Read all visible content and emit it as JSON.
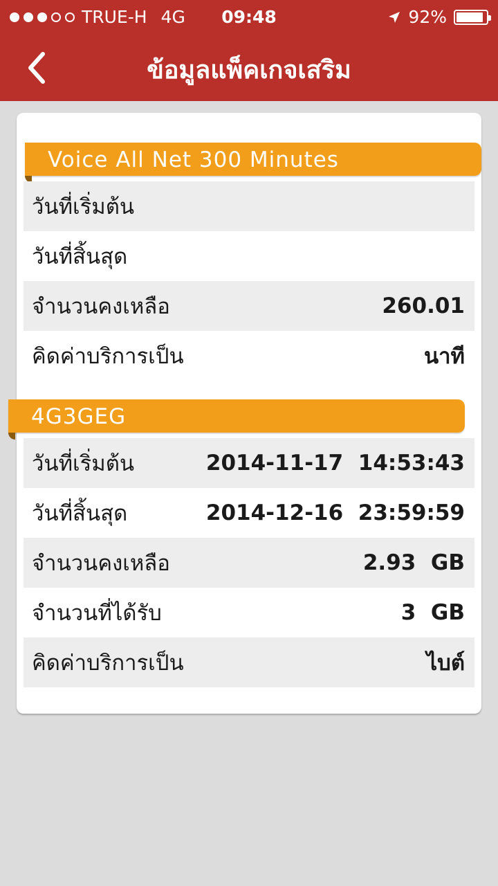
{
  "status_bar": {
    "signal_dots_filled": 3,
    "signal_dots_total": 5,
    "carrier": "TRUE-H",
    "network": "4G",
    "time": "09:48",
    "battery": "92%",
    "battery_level": 0.92
  },
  "header": {
    "title": "ข้อมูลแพ็คเกจเสริม",
    "back_icon": "chevron-left-icon"
  },
  "colors": {
    "header_bg": "#b9302b",
    "section_bg": "#f29e1a",
    "page_bg": "#dcdcdc"
  },
  "packages": [
    {
      "name": "Voice All Net 300 Minutes",
      "rows": [
        {
          "label": "วันที่เริ่มต้น",
          "value": ""
        },
        {
          "label": "วันที่สิ้นสุด",
          "value": ""
        },
        {
          "label": "จำนวนคงเหลือ",
          "value": "260.01"
        },
        {
          "label": "คิดค่าบริการเป็น",
          "value": "นาที"
        }
      ]
    },
    {
      "name": "4G3GEG",
      "rows": [
        {
          "label": "วันที่เริ่มต้น",
          "value": "2014-11-17  14:53:43"
        },
        {
          "label": "วันที่สิ้นสุด",
          "value": "2014-12-16  23:59:59"
        },
        {
          "label": "จำนวนคงเหลือ",
          "value": "2.93  GB"
        },
        {
          "label": "จำนวนที่ได้รับ",
          "value": "3  GB"
        },
        {
          "label": "คิดค่าบริการเป็น",
          "value": "ไบต์"
        }
      ]
    }
  ]
}
